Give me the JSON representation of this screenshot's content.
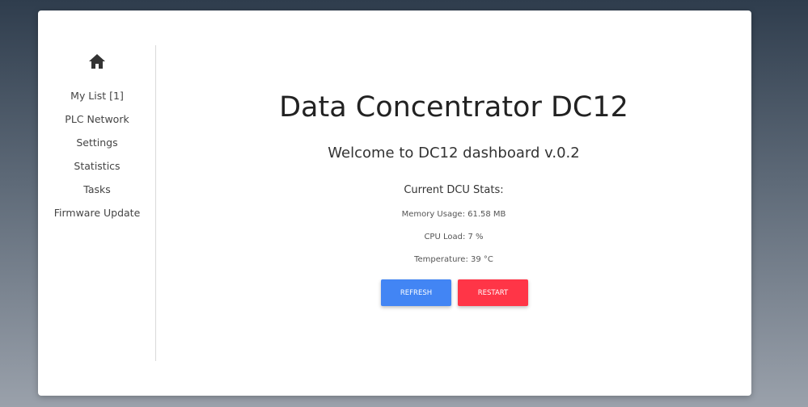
{
  "sidebar": {
    "home_icon": "home-icon",
    "items": [
      {
        "label": "My List [1]"
      },
      {
        "label": "PLC Network"
      },
      {
        "label": "Settings"
      },
      {
        "label": "Statistics"
      },
      {
        "label": "Tasks"
      },
      {
        "label": "Firmware Update"
      }
    ]
  },
  "main": {
    "title": "Data Concentrator DC12",
    "welcome": "Welcome to DC12 dashboard v.0.2",
    "stats_heading": "Current DCU Stats:",
    "memory": "Memory Usage: 61.58 MB",
    "cpu": "CPU Load: 7 %",
    "temperature": "Temperature: 39 °C",
    "refresh_label": "Refresh",
    "restart_label": "Restart"
  },
  "colors": {
    "refresh": "#4285f4",
    "restart": "#ff3547"
  }
}
